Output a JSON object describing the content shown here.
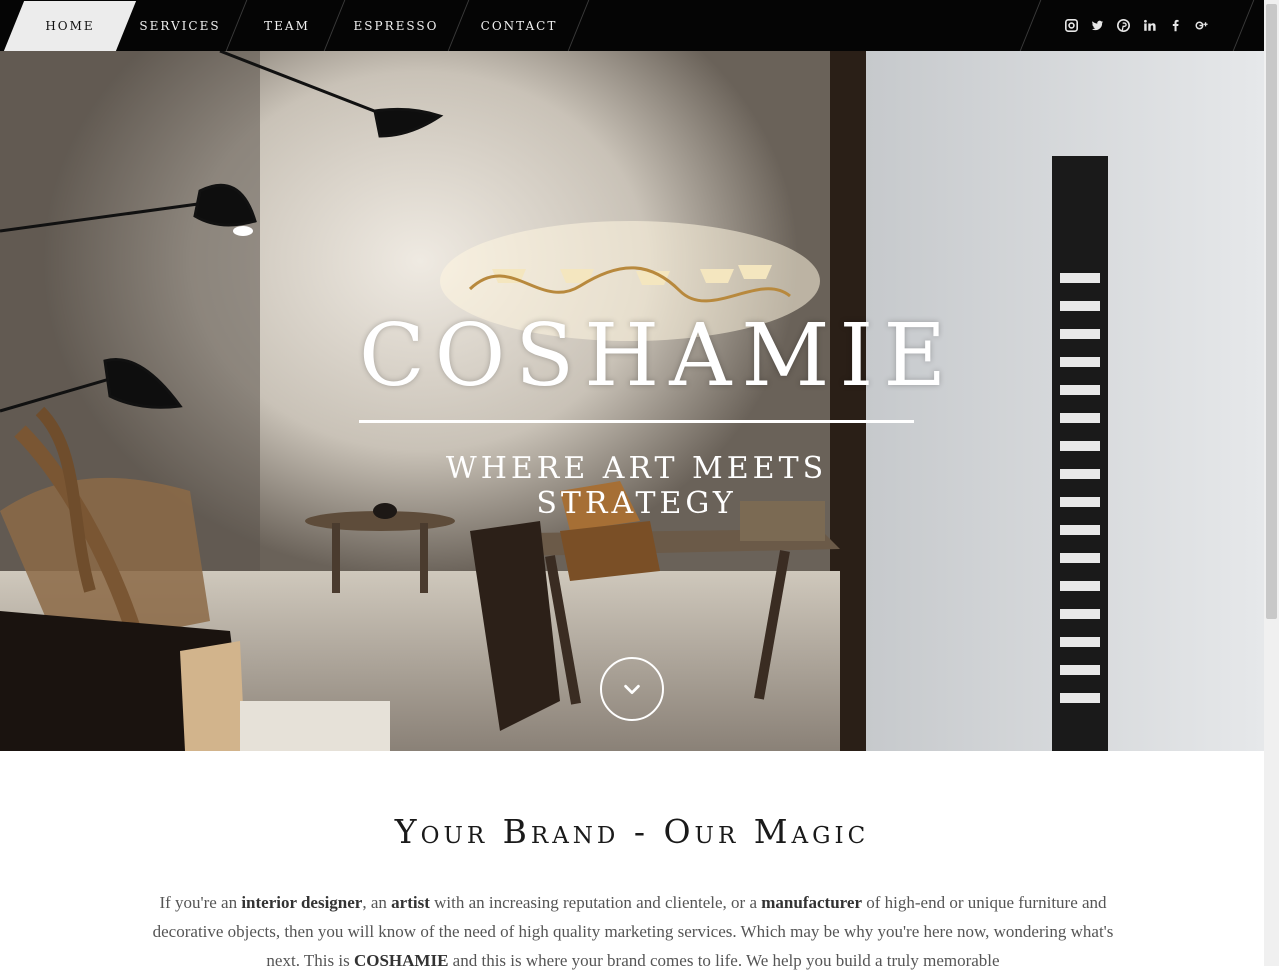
{
  "nav": {
    "items": [
      {
        "label": "Home",
        "active": true
      },
      {
        "label": "Services",
        "active": false
      },
      {
        "label": "Team",
        "active": false
      },
      {
        "label": "Espresso",
        "active": false
      },
      {
        "label": "Contact",
        "active": false
      }
    ],
    "social": [
      "instagram-icon",
      "twitter-icon",
      "pinterest-icon",
      "linkedin-icon",
      "facebook-icon",
      "google-plus-icon"
    ]
  },
  "hero": {
    "title": "COSHAMIE",
    "tagline": "Where art meets strategy",
    "scroll_icon": "chevron-down-icon"
  },
  "intro": {
    "heading": "Your Brand - Our Magic",
    "p1": "If you're an ",
    "b1": "interior designer",
    "p2": ", an ",
    "b2": "artist",
    "p3": " with an increasing reputation and clientele, or a ",
    "b3": "manufacturer",
    "p4": " of high-end or unique furniture and decorative objects, then you will know of the need of high quality marketing services. Which may be why you're here now, wondering what's next. This is ",
    "b4": "COSHAMIE",
    "p5": " and this is where your brand comes to life. We help you build a truly memorable"
  },
  "colors": {
    "nav_bg": "#050505",
    "nav_active_bg": "#ececec",
    "heading_text": "#1a1a1a",
    "body_text": "#555555"
  }
}
